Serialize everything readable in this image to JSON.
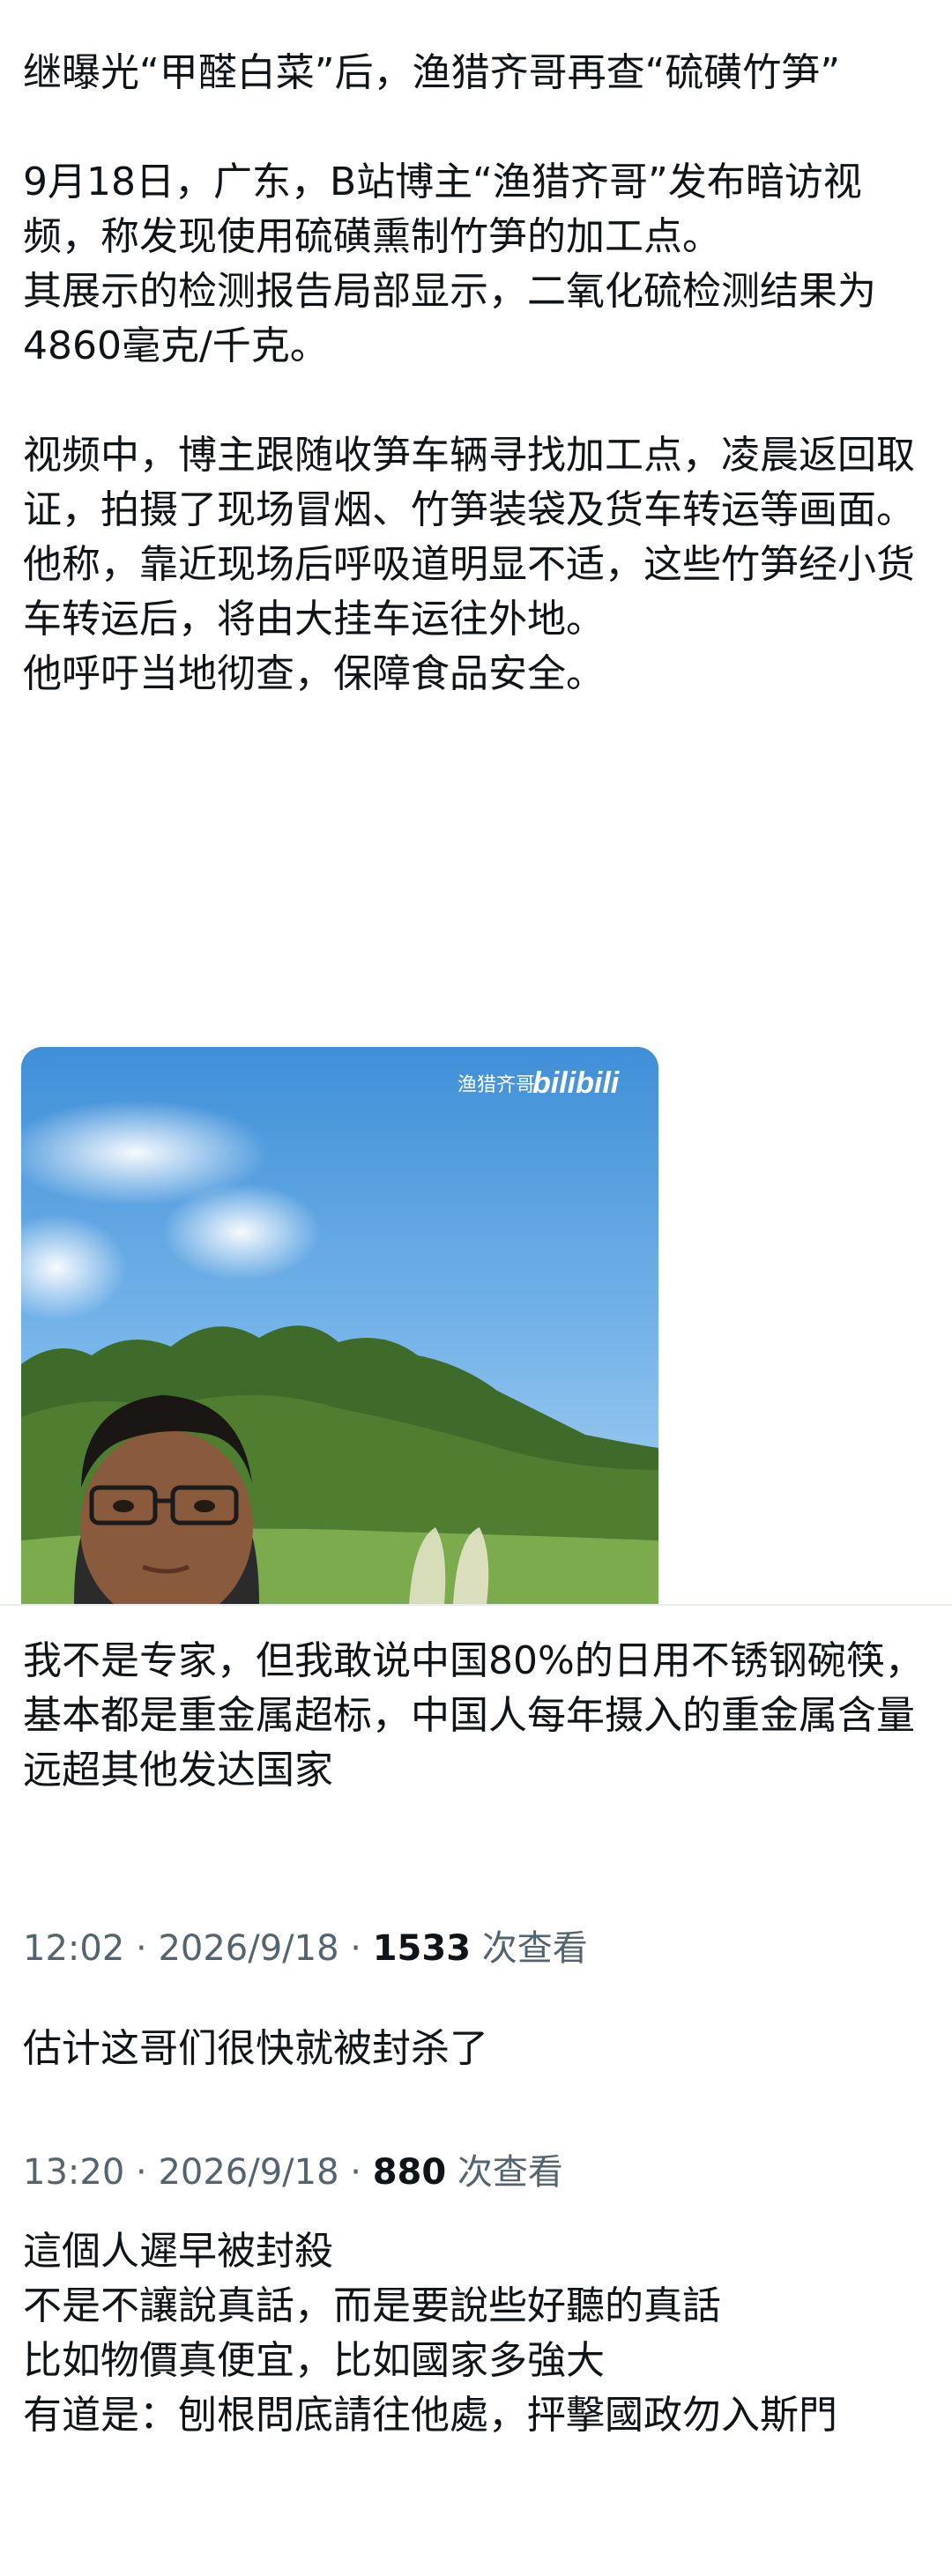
{
  "post": {
    "text": "继曝光“甲醛白菜”后，渔猎齐哥再查“硫磺竹笋”\n\n9月18日，广东，B站博主“渔猎齐哥”发布暗访视频，称发现使用硫磺熏制竹笋的加工点。\n其展示的检测报告局部显示，二氧化硫检测结果为4860毫克/千克。\n\n视频中，博主跟随收笋车辆寻找加工点，凌晨返回取证，拍摄了现场冒烟、竹笋装袋及货车转运等画面。\n他称，靠近现场后呼吸道明显不适，这些竹笋经小货车转运后，将由大挂车运往外地。\n他呼吁当地彻查，保障食品安全。"
  },
  "media": {
    "watermark_channel": "渔猎齐哥",
    "watermark_brand": "bilibili"
  },
  "replies": [
    {
      "text": "我不是专家，但我敢说中国80%的日用不锈钢碗筷，基本都是重金属超标，中国人每年摄入的重金属含量远超其他发达国家",
      "time": "12:02",
      "sep1": " · ",
      "date": "2026/9/18",
      "sep2": " · ",
      "views": "1533",
      "views_label": " 次查看"
    },
    {
      "text": "估计这哥们很快就被封杀了",
      "time": "13:20",
      "sep1": " · ",
      "date": "2026/9/18",
      "sep2": " · ",
      "views": "880",
      "views_label": " 次查看"
    },
    {
      "text": "這個人遲早被封殺\n不是不讓說真話，而是要說些好聽的真話\n比如物價真便宜，比如國家多強大\n有道是：刨根問底請往他處，抨擊國政勿入斯門"
    }
  ]
}
